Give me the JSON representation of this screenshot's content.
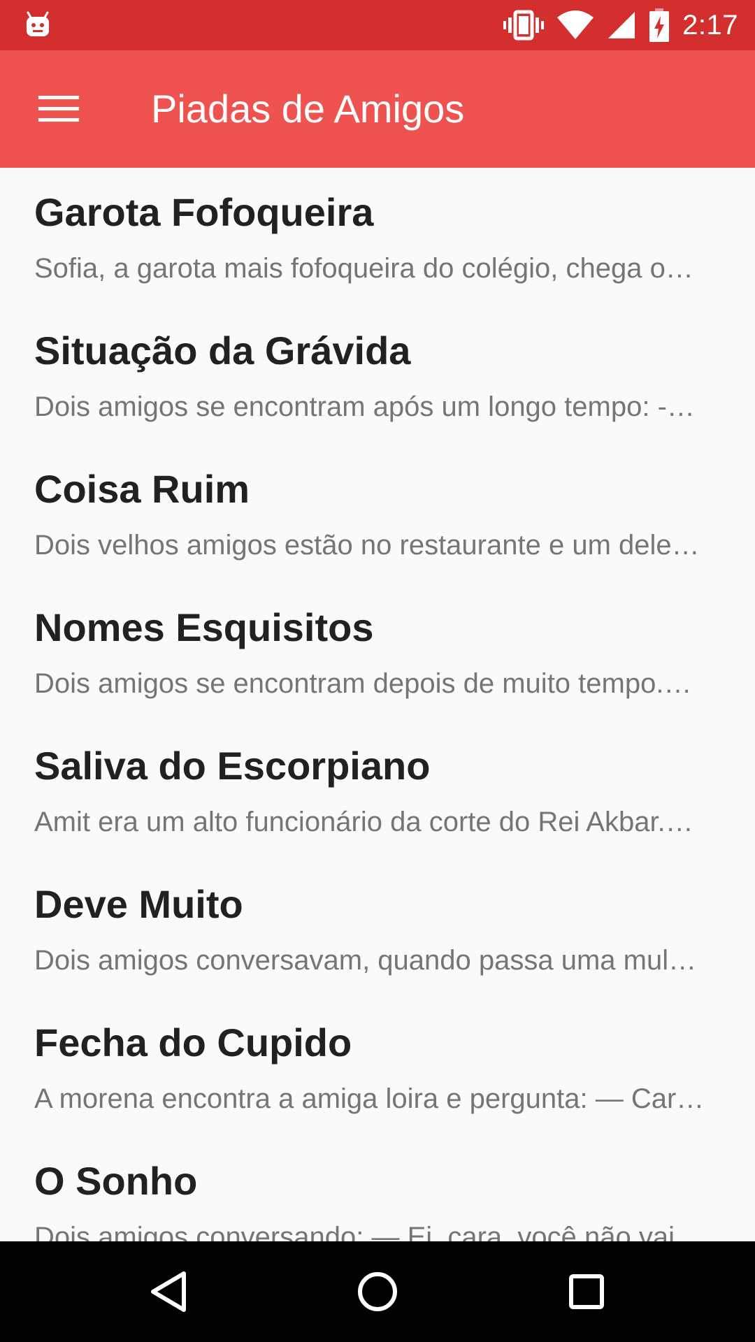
{
  "status_bar": {
    "time": "2:17",
    "icons": [
      "android-notification-icon",
      "vibrate-icon",
      "wifi-icon",
      "cell-signal-icon",
      "battery-charging-icon"
    ]
  },
  "app_bar": {
    "menu_icon": "hamburger-menu-icon",
    "title": "Piadas de Amigos",
    "color": "#ef5350",
    "status_color": "#d32f2f"
  },
  "jokes": [
    {
      "title": "Garota Fofoqueira",
      "preview": "Sofia, a garota mais fofoqueira do colégio, chega o…"
    },
    {
      "title": "Situação da Grávida",
      "preview": "Dois amigos se encontram após um longo tempo: -…"
    },
    {
      "title": "Coisa Ruim",
      "preview": "Dois velhos amigos estão no restaurante e um dele…"
    },
    {
      "title": "Nomes Esquisitos",
      "preview": "Dois amigos se encontram depois de muito tempo.…"
    },
    {
      "title": "Saliva do Escorpiano",
      "preview": "Amit era um alto funcionário da corte do Rei Akbar.…"
    },
    {
      "title": "Deve Muito",
      "preview": "Dois amigos conversavam, quando passa uma mul…"
    },
    {
      "title": "Fecha do Cupido",
      "preview": "A morena encontra a amiga loira e pergunta: — Car…"
    },
    {
      "title": "O Sonho",
      "preview": "Dois amigos conversando: — Ei, cara, você não vai…"
    }
  ],
  "nav_bar": {
    "icons": [
      "back-icon",
      "home-icon",
      "recents-icon"
    ]
  }
}
